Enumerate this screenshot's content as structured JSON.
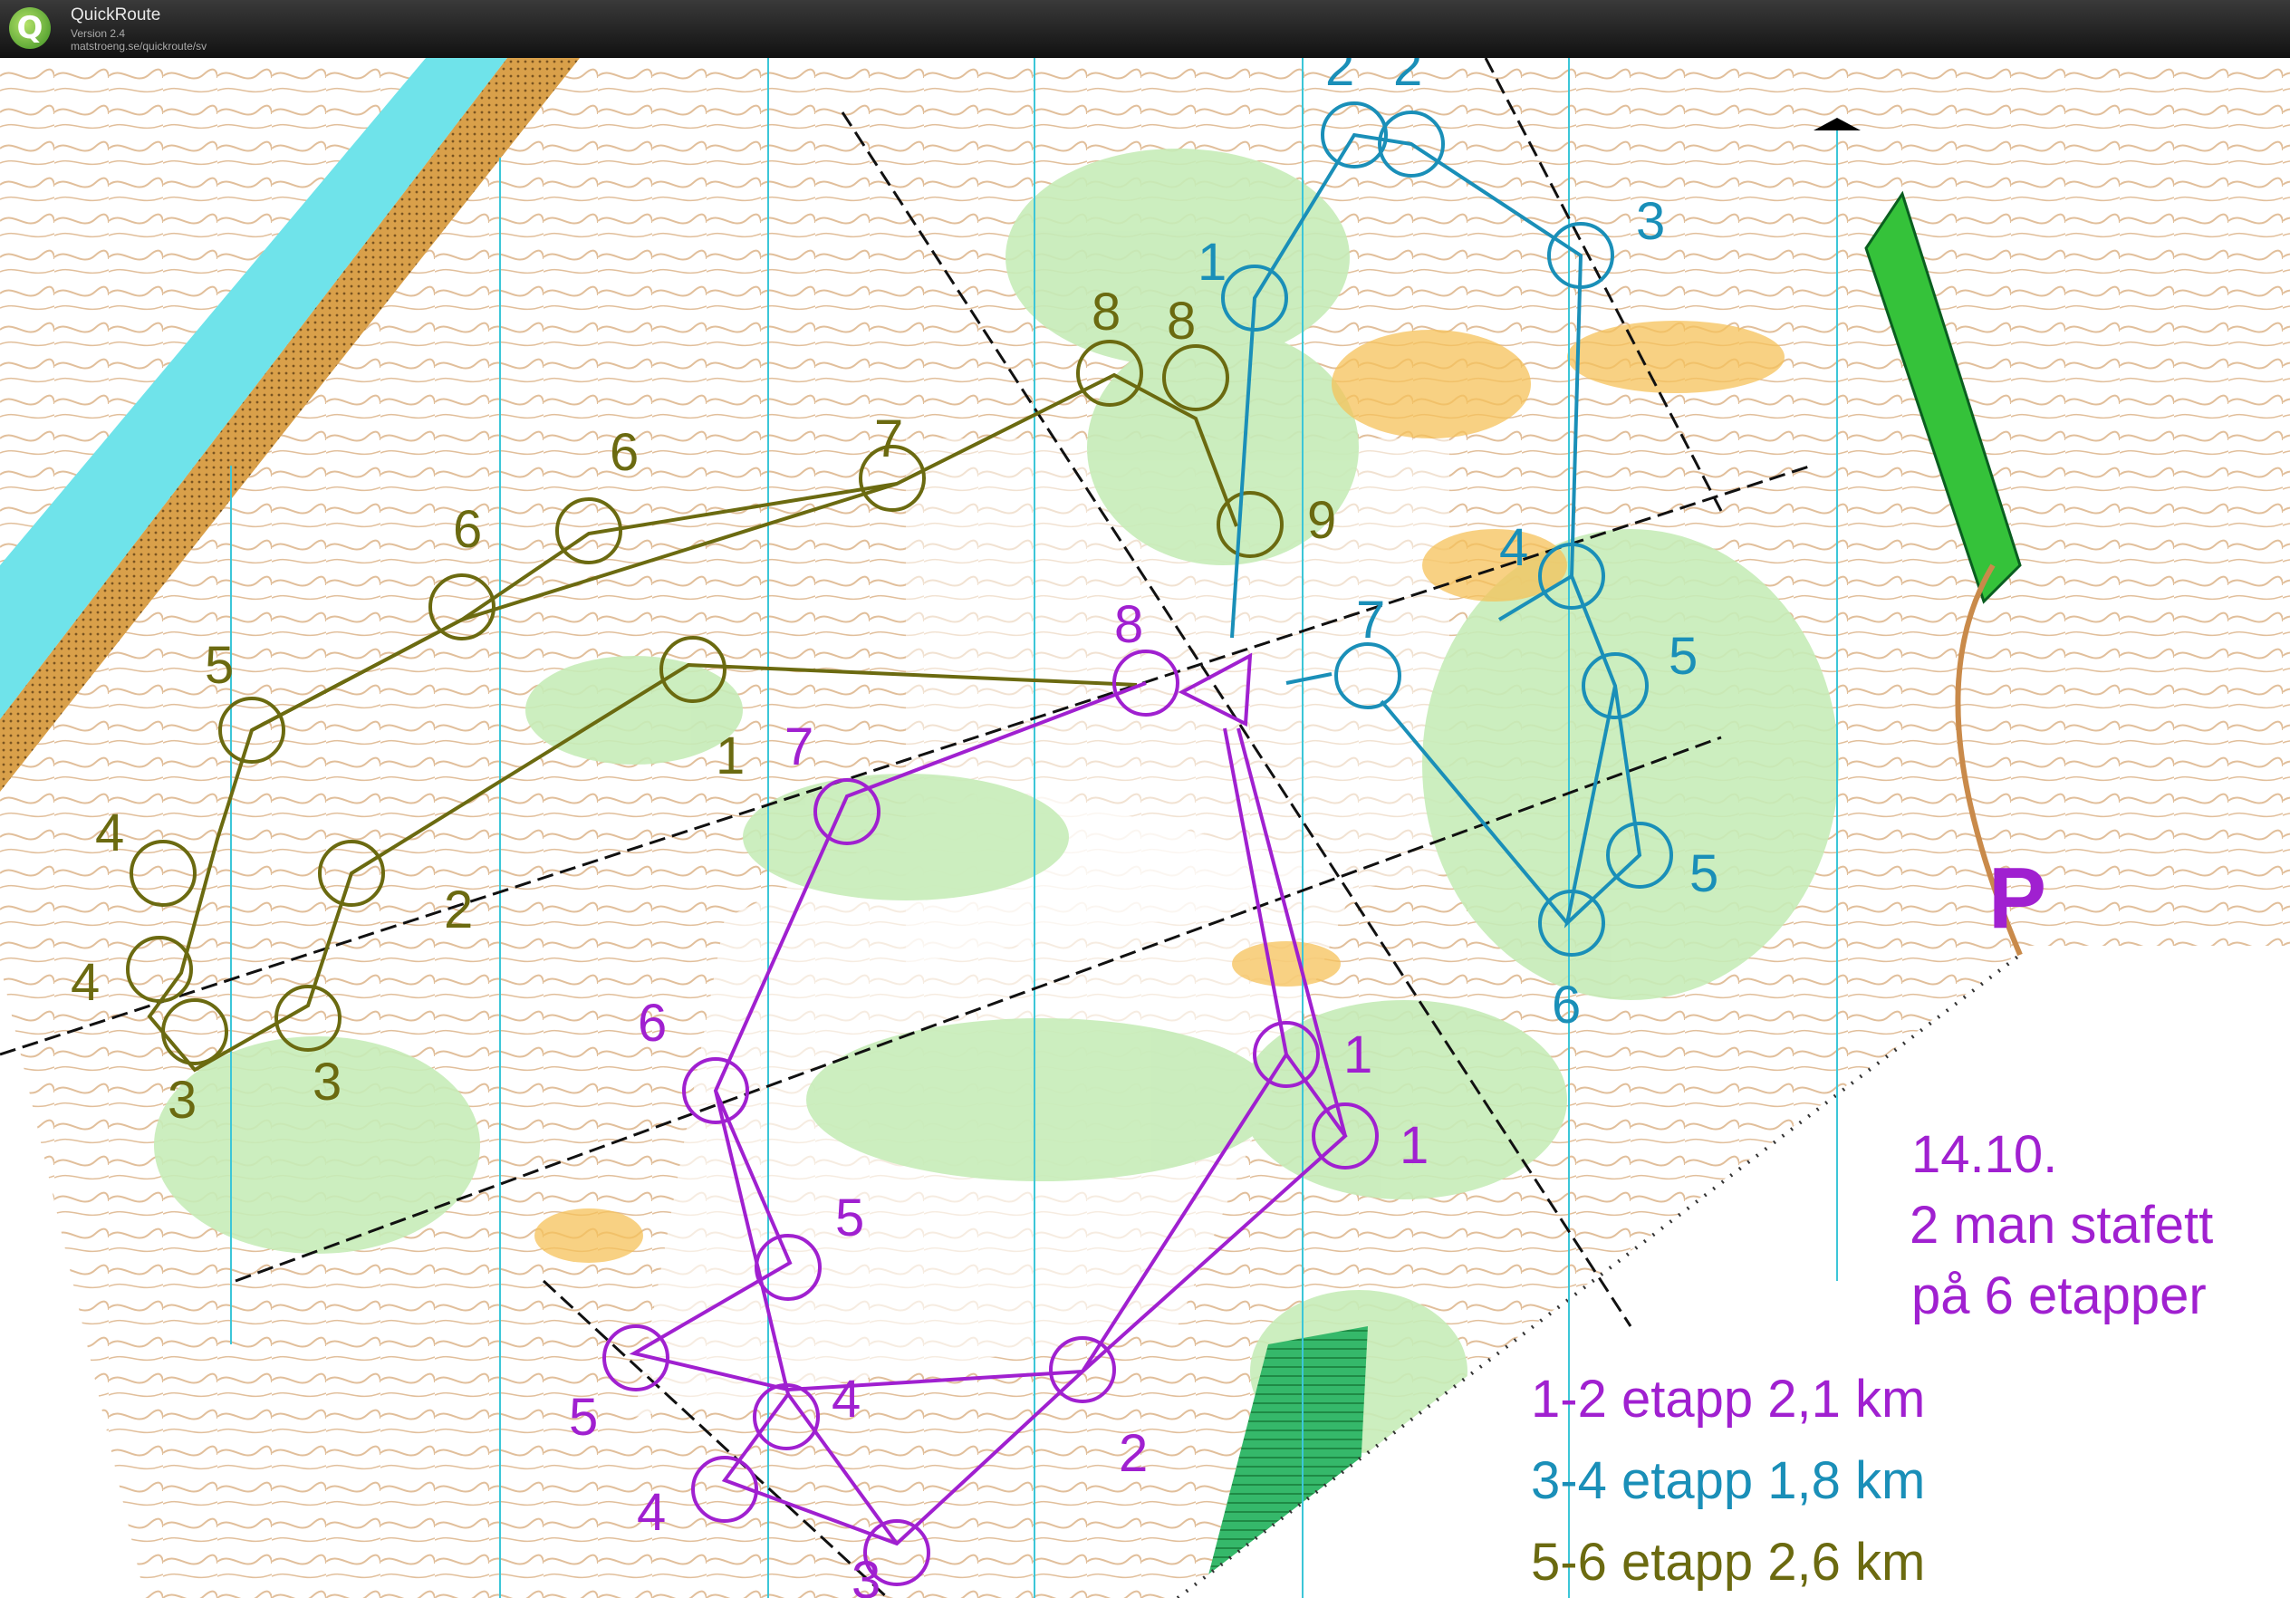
{
  "window": {
    "app_name": "QuickRoute",
    "version": "Version 2.4",
    "url": "matstroeng.se/quickroute/sv",
    "app_icon_glyph": "Q"
  },
  "map": {
    "parking_symbol": "P",
    "legend": {
      "date": "14.10.",
      "line2": "2 man stafett",
      "line3": "på 6 etapper",
      "leg12": "1-2 etapp 2,1 km",
      "leg34": "3-4 etapp 1,8 km",
      "leg56": "5-6 etapp 2,6 km"
    },
    "colors": {
      "purple_course": "#a020d0",
      "blue_course": "#1a8fb8",
      "olive_course": "#6b6a10",
      "forest_green": "#c6ecb8",
      "contour_brown": "#b8733a",
      "lake_blue": "#6fe3ea",
      "open_yellow": "#f6c25a",
      "marsh_green": "#3fc46e"
    },
    "course_purple_labels": [
      "8",
      "7",
      "6",
      "5",
      "5",
      "4",
      "4",
      "2",
      "1",
      "1",
      "3"
    ],
    "course_blue_labels": [
      "2",
      "2",
      "1",
      "3",
      "4",
      "5",
      "5",
      "6",
      "7"
    ],
    "course_olive_labels": [
      "8",
      "8",
      "7",
      "6",
      "6",
      "5",
      "4",
      "4",
      "3",
      "3",
      "2",
      "1",
      "9"
    ]
  }
}
